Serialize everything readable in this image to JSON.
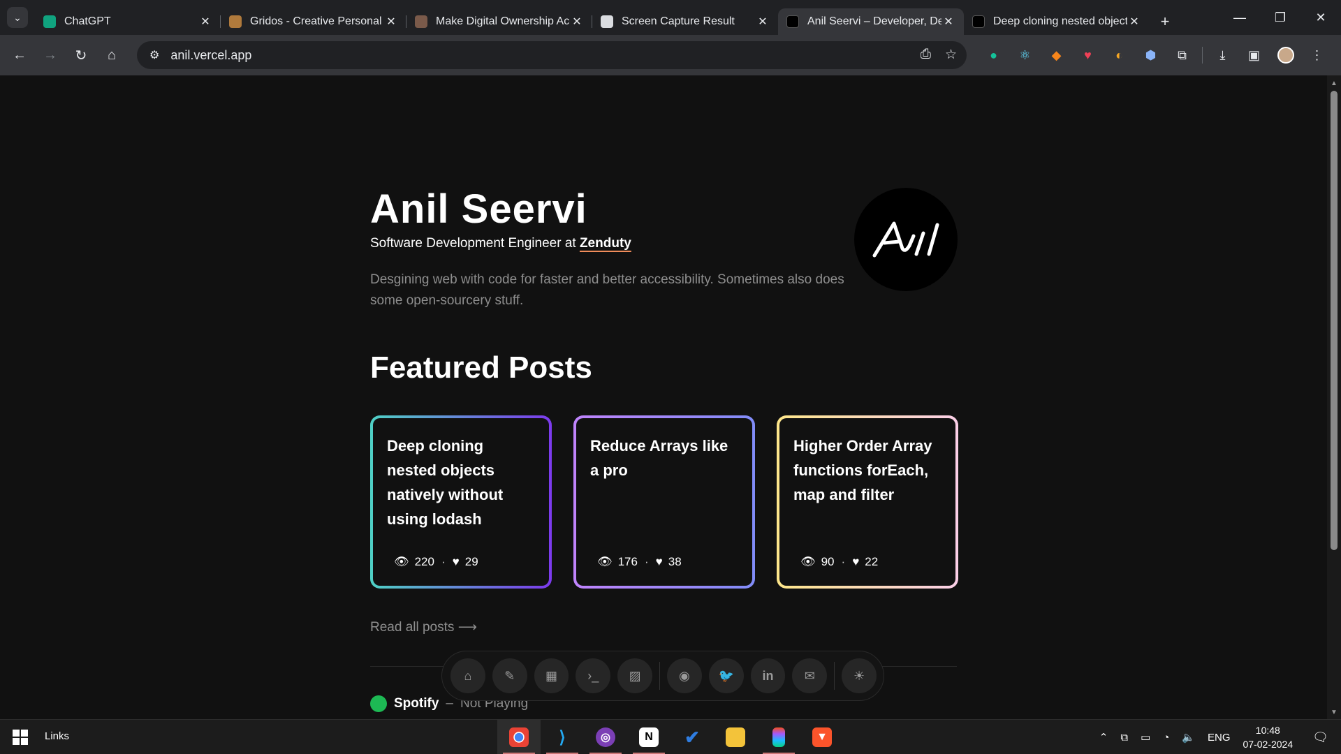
{
  "browser": {
    "tabs": [
      {
        "title": "ChatGPT",
        "color": "#10a37f"
      },
      {
        "title": "Gridos - Creative Personal Portfolio",
        "color": "#b07a3c"
      },
      {
        "title": "Make Digital Ownership Accessible",
        "color": "#7a5a4a"
      },
      {
        "title": "Screen Capture Result",
        "color": "#dadce0"
      },
      {
        "title": "Anil Seervi – Developer, Designer",
        "color": "#000000",
        "active": true
      },
      {
        "title": "Deep cloning nested objects",
        "color": "#000000"
      }
    ],
    "url": "anil.vercel.app"
  },
  "profile": {
    "name": "Anil Seervi",
    "role_prefix": "Software Development Engineer at",
    "company": "Zenduty",
    "description": "Desgining web with code for faster and better accessibility. Sometimes also does some open-sourcery stuff."
  },
  "featured": {
    "title": "Featured Posts",
    "posts": [
      {
        "title": "Deep cloning nested objects natively without using lodash",
        "views": "220",
        "likes": "29"
      },
      {
        "title": "Reduce Arrays like a pro",
        "views": "176",
        "likes": "38"
      },
      {
        "title": "Higher Order Array functions forEach, map and filter",
        "views": "90",
        "likes": "22"
      }
    ],
    "read_all": "Read all posts"
  },
  "spotify": {
    "label": "Spotify",
    "separator": "–",
    "status": "Not Playing"
  },
  "dock_icons": [
    "home-icon",
    "pen-icon",
    "box-icon",
    "terminal-icon",
    "image-icon",
    "github-icon",
    "twitter-icon",
    "linkedin-icon",
    "mail-icon",
    "sun-icon"
  ],
  "taskbar": {
    "links_label": "Links",
    "language": "ENG",
    "time": "10:48",
    "date": "07-02-2024"
  }
}
